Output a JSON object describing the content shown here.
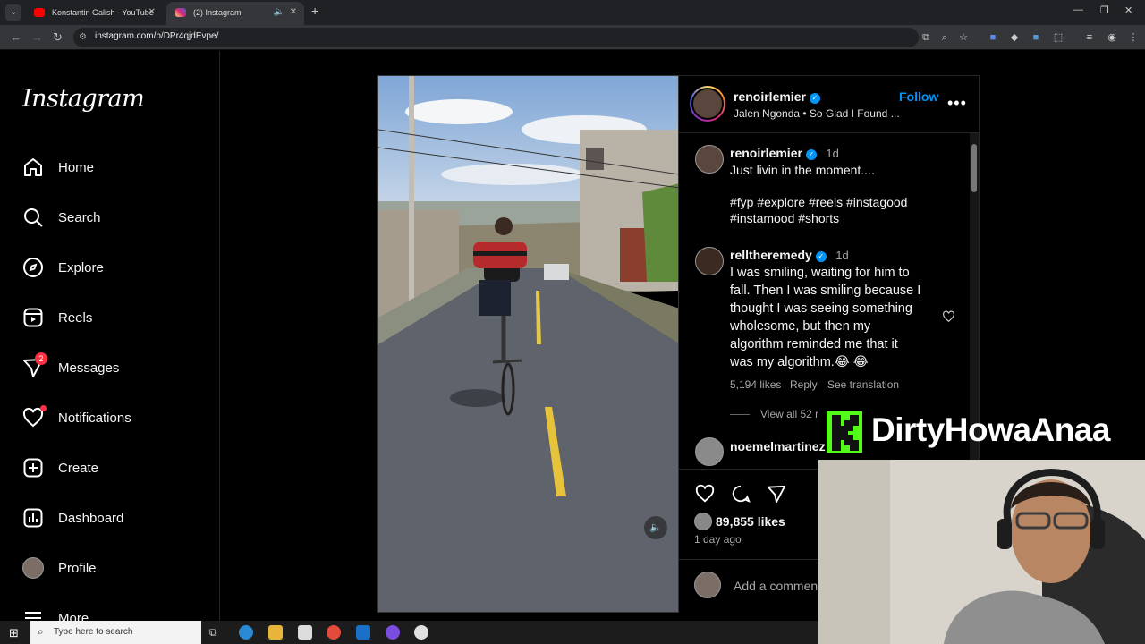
{
  "browser": {
    "tabs": [
      {
        "title": "Konstantin Galish - YouTube",
        "favicon": "youtube-icon",
        "color": "#ff0000",
        "active": false
      },
      {
        "title": "(2) Instagram",
        "favicon": "instagram-icon",
        "color": "#d62976",
        "active": true
      }
    ],
    "url": "instagram.com/p/DPr4qjdEvpe/"
  },
  "sidebar": {
    "logo": "Instagram",
    "items": [
      {
        "label": "Home",
        "icon": "home-icon"
      },
      {
        "label": "Search",
        "icon": "search-icon"
      },
      {
        "label": "Explore",
        "icon": "compass-icon"
      },
      {
        "label": "Reels",
        "icon": "reels-icon"
      },
      {
        "label": "Messages",
        "icon": "messenger-icon",
        "badge": "2"
      },
      {
        "label": "Notifications",
        "icon": "heart-icon"
      },
      {
        "label": "Create",
        "icon": "plus-square-icon"
      },
      {
        "label": "Dashboard",
        "icon": "dashboard-icon"
      },
      {
        "label": "Profile",
        "icon": "avatar"
      },
      {
        "label": "More",
        "icon": "menu-icon"
      }
    ]
  },
  "post": {
    "author": "renoirlemier",
    "audio": "Jalen Ngonda • So Glad I Found ...",
    "follow_label": "Follow",
    "caption": {
      "username": "renoirlemier",
      "time": "1d",
      "text": "Just livin in the moment....",
      "hashtags_line1": "#fyp #explore #reels #instagood",
      "hashtags_line2": "#instamood #shorts"
    },
    "comments": [
      {
        "username": "relltheremedy",
        "time": "1d",
        "lines": [
          "I was smiling, waiting for him to",
          "fall. Then I was smiling because I",
          "thought I was seeing something",
          "wholesome, but then my",
          "algorithm reminded me that it",
          "was my algorithm.😂 😂"
        ],
        "likes": "5,194 likes",
        "reply": "Reply",
        "translation": "See translation",
        "view_replies": "View all 52 r"
      },
      {
        "username": "noemelmartinez"
      }
    ],
    "likes": "89,855 likes",
    "posted": "1 day ago",
    "add_comment_placeholder": "Add a commen"
  },
  "overlay": {
    "banner_logo": "K",
    "banner_text": "DirtyHowaAnaa"
  },
  "taskbar": {
    "search_placeholder": "Type here to search"
  },
  "colors": {
    "accent": "#0095f6",
    "badge": "#ff3040",
    "kick": "#53fc18"
  }
}
